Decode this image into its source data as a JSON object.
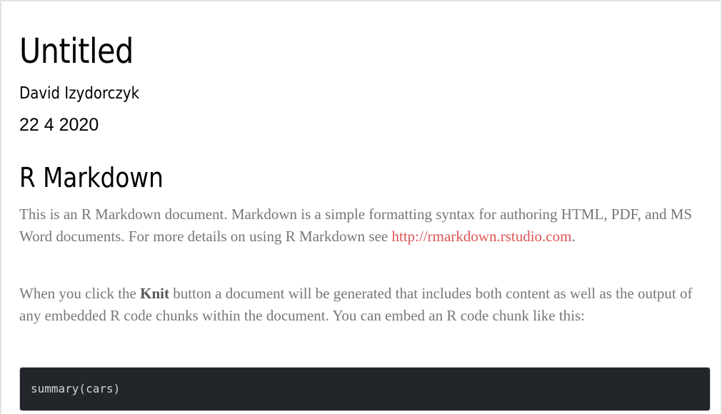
{
  "document": {
    "title": "Untitled",
    "author": "David Izydorczyk",
    "date": "22 4 2020"
  },
  "section": {
    "heading": "R Markdown",
    "paragraph1": {
      "text_before_link": "This is an R Markdown document. Markdown is a simple formatting syntax for authoring HTML, PDF, and MS Word documents. For more details on using R Markdown see ",
      "link_text": "http://rmarkdown.rstudio.com",
      "text_after_link": "."
    },
    "paragraph2": {
      "text_before_bold": "When you click the ",
      "bold_text": "Knit",
      "text_after_bold": " button a document will be generated that includes both content as well as the output of any embedded R code chunks within the document. You can embed an R code chunk like this:"
    },
    "code": "summary(cars)"
  },
  "colors": {
    "body_text": "#777777",
    "link": "#dd5555",
    "code_background": "#222529",
    "code_text": "#d4d4d4"
  }
}
